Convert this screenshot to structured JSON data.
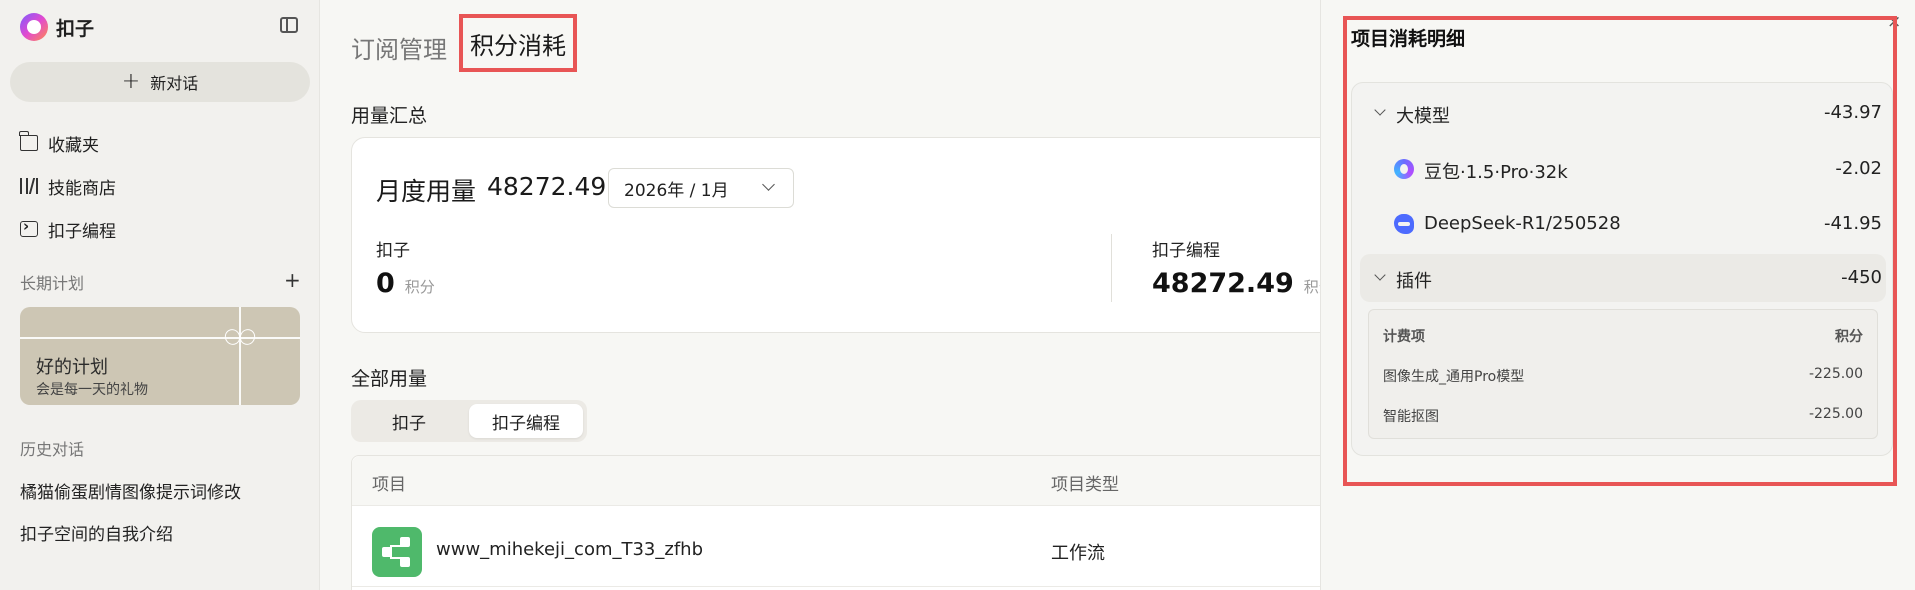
{
  "sidebar": {
    "logo_text": "扣子",
    "new_chat_label": "新对话",
    "nav_items": [
      {
        "label": "收藏夹",
        "icon": "folder-icon"
      },
      {
        "label": "技能商店",
        "icon": "books-icon"
      },
      {
        "label": "扣子编程",
        "icon": "code-icon"
      }
    ],
    "plans_title": "长期计划",
    "plan_card": {
      "title": "好的计划",
      "subtitle": "会是每一天的礼物"
    },
    "history_title": "历史对话",
    "history_items": [
      "橘猫偷蛋剧情图像提示词修改",
      "扣子空间的自我介绍"
    ]
  },
  "main": {
    "tabs": [
      {
        "label": "订阅管理"
      },
      {
        "label": "积分消耗"
      }
    ],
    "usage_summary_title": "用量汇总",
    "monthly_label": "月度用量",
    "monthly_value": "48272.49",
    "date_selected": "2026年 / 1月",
    "stats": [
      {
        "label": "扣子",
        "value": "0",
        "unit": "积分"
      },
      {
        "label": "扣子编程",
        "value": "48272.49",
        "unit": "积分"
      }
    ],
    "all_usage_title": "全部用量",
    "segments": [
      {
        "label": "扣子"
      },
      {
        "label": "扣子编程"
      }
    ],
    "active_segment": "扣子编程",
    "table": {
      "headers": [
        "项目",
        "项目类型"
      ],
      "rows": [
        {
          "name": "www_mihekeji_com_T33_zfhb",
          "type": "工作流"
        }
      ]
    }
  },
  "drawer": {
    "title": "项目消耗明细",
    "close_glyph": "×",
    "groups": [
      {
        "label": "大模型",
        "value": "-43.97",
        "models": [
          {
            "label": "豆包·1.5·Pro·32k",
            "value": "-2.02",
            "icon": "doubao-icon"
          },
          {
            "label": "DeepSeek-R1/250528",
            "value": "-41.95",
            "icon": "deepseek-icon"
          }
        ]
      },
      {
        "label": "插件",
        "value": "-450",
        "fee_table": {
          "headers": [
            "计费项",
            "积分"
          ],
          "rows": [
            {
              "item": "图像生成_通用Pro模型",
              "points": "-225.00"
            },
            {
              "item": "智能抠图",
              "points": "-225.00"
            }
          ]
        }
      }
    ]
  },
  "colors": {
    "highlight": "#e85555",
    "workflow_icon": "#4fb96b"
  }
}
